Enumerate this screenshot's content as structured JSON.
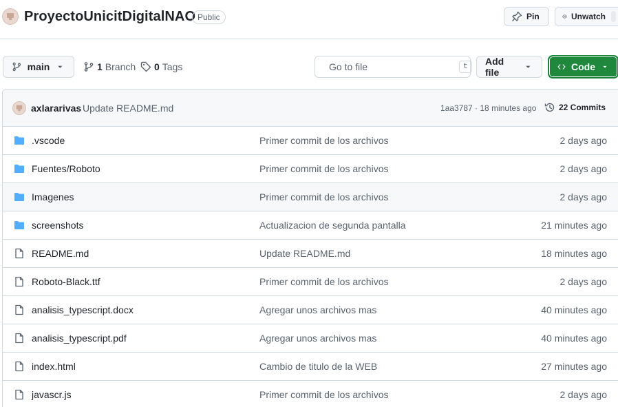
{
  "repo": {
    "name": "ProyectoUnicitDigitalNAO",
    "visibility": "Public",
    "pin_label": "Pin",
    "watch_label": "Unwatch"
  },
  "toolbar": {
    "branch": "main",
    "branches_count": "1",
    "branches_label": "Branch",
    "tags_count": "0",
    "tags_label": "Tags",
    "search_placeholder": "Go to file",
    "search_shortcut": "t",
    "add_file_label": "Add file",
    "code_label": "Code"
  },
  "latest_commit": {
    "author": "axlararivas",
    "message": "Update README.md",
    "hash_time": "1aa3787 · 18 minutes ago",
    "commits_count": "22 Commits"
  },
  "files": [
    {
      "name": ".vscode",
      "type": "folder",
      "commit": "Primer commit de los archivos",
      "age": "2 days ago"
    },
    {
      "name": "Fuentes/Roboto",
      "type": "folder",
      "commit": "Primer commit de los archivos",
      "age": "2 days ago"
    },
    {
      "name": "Imagenes",
      "type": "folder",
      "commit": "Primer commit de los archivos",
      "age": "2 days ago"
    },
    {
      "name": "screenshots",
      "type": "folder",
      "commit": "Actualizacion de segunda pantalla",
      "age": "21 minutes ago"
    },
    {
      "name": "README.md",
      "type": "file",
      "commit": "Update README.md",
      "age": "18 minutes ago"
    },
    {
      "name": "Roboto-Black.ttf",
      "type": "file",
      "commit": "Primer commit de los archivos",
      "age": "2 days ago"
    },
    {
      "name": "analisis_typescript.docx",
      "type": "file",
      "commit": "Agregar unos archivos mas",
      "age": "40 minutes ago"
    },
    {
      "name": "analisis_typescript.pdf",
      "type": "file",
      "commit": "Agregar unos archivos mas",
      "age": "40 minutes ago"
    },
    {
      "name": "index.html",
      "type": "file",
      "commit": "Cambio de titulo de la WEB",
      "age": "27 minutes ago"
    },
    {
      "name": "javascr.js",
      "type": "file",
      "commit": "Primer commit de los archivos",
      "age": "2 days ago"
    }
  ],
  "colors": {
    "folder": "#54aeff",
    "code_button": "#1f883d",
    "border": "#d1d9e0",
    "muted_text": "#59636e"
  },
  "icons": {
    "repo_avatar": "avatar-icon",
    "pin": "pin-icon",
    "watch": "eye-icon",
    "branch": "git-branch-icon",
    "tag": "tag-icon",
    "search": "search-icon",
    "code": "code-icon",
    "history": "history-icon",
    "folder": "folder-icon",
    "file": "file-icon"
  }
}
